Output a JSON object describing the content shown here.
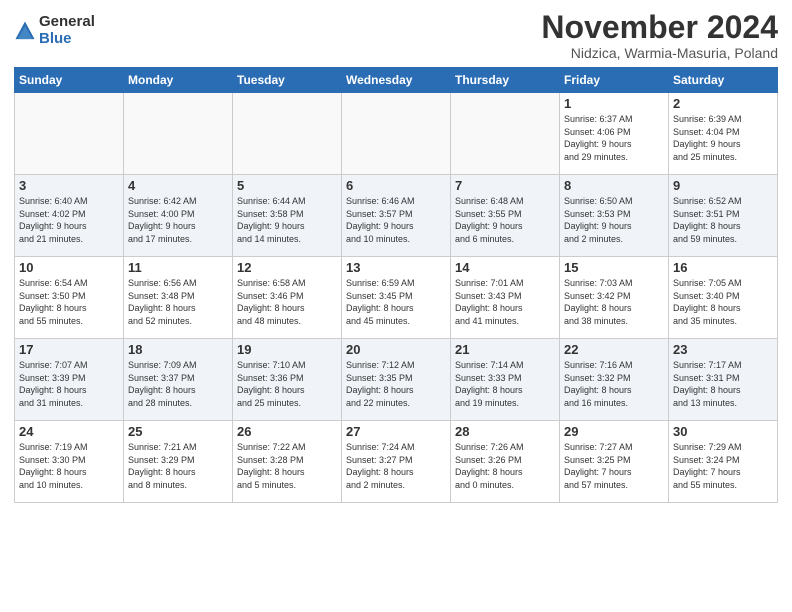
{
  "logo": {
    "general": "General",
    "blue": "Blue"
  },
  "header": {
    "month": "November 2024",
    "location": "Nidzica, Warmia-Masuria, Poland"
  },
  "weekdays": [
    "Sunday",
    "Monday",
    "Tuesday",
    "Wednesday",
    "Thursday",
    "Friday",
    "Saturday"
  ],
  "weeks": [
    [
      {
        "day": "",
        "info": ""
      },
      {
        "day": "",
        "info": ""
      },
      {
        "day": "",
        "info": ""
      },
      {
        "day": "",
        "info": ""
      },
      {
        "day": "",
        "info": ""
      },
      {
        "day": "1",
        "info": "Sunrise: 6:37 AM\nSunset: 4:06 PM\nDaylight: 9 hours\nand 29 minutes."
      },
      {
        "day": "2",
        "info": "Sunrise: 6:39 AM\nSunset: 4:04 PM\nDaylight: 9 hours\nand 25 minutes."
      }
    ],
    [
      {
        "day": "3",
        "info": "Sunrise: 6:40 AM\nSunset: 4:02 PM\nDaylight: 9 hours\nand 21 minutes."
      },
      {
        "day": "4",
        "info": "Sunrise: 6:42 AM\nSunset: 4:00 PM\nDaylight: 9 hours\nand 17 minutes."
      },
      {
        "day": "5",
        "info": "Sunrise: 6:44 AM\nSunset: 3:58 PM\nDaylight: 9 hours\nand 14 minutes."
      },
      {
        "day": "6",
        "info": "Sunrise: 6:46 AM\nSunset: 3:57 PM\nDaylight: 9 hours\nand 10 minutes."
      },
      {
        "day": "7",
        "info": "Sunrise: 6:48 AM\nSunset: 3:55 PM\nDaylight: 9 hours\nand 6 minutes."
      },
      {
        "day": "8",
        "info": "Sunrise: 6:50 AM\nSunset: 3:53 PM\nDaylight: 9 hours\nand 2 minutes."
      },
      {
        "day": "9",
        "info": "Sunrise: 6:52 AM\nSunset: 3:51 PM\nDaylight: 8 hours\nand 59 minutes."
      }
    ],
    [
      {
        "day": "10",
        "info": "Sunrise: 6:54 AM\nSunset: 3:50 PM\nDaylight: 8 hours\nand 55 minutes."
      },
      {
        "day": "11",
        "info": "Sunrise: 6:56 AM\nSunset: 3:48 PM\nDaylight: 8 hours\nand 52 minutes."
      },
      {
        "day": "12",
        "info": "Sunrise: 6:58 AM\nSunset: 3:46 PM\nDaylight: 8 hours\nand 48 minutes."
      },
      {
        "day": "13",
        "info": "Sunrise: 6:59 AM\nSunset: 3:45 PM\nDaylight: 8 hours\nand 45 minutes."
      },
      {
        "day": "14",
        "info": "Sunrise: 7:01 AM\nSunset: 3:43 PM\nDaylight: 8 hours\nand 41 minutes."
      },
      {
        "day": "15",
        "info": "Sunrise: 7:03 AM\nSunset: 3:42 PM\nDaylight: 8 hours\nand 38 minutes."
      },
      {
        "day": "16",
        "info": "Sunrise: 7:05 AM\nSunset: 3:40 PM\nDaylight: 8 hours\nand 35 minutes."
      }
    ],
    [
      {
        "day": "17",
        "info": "Sunrise: 7:07 AM\nSunset: 3:39 PM\nDaylight: 8 hours\nand 31 minutes."
      },
      {
        "day": "18",
        "info": "Sunrise: 7:09 AM\nSunset: 3:37 PM\nDaylight: 8 hours\nand 28 minutes."
      },
      {
        "day": "19",
        "info": "Sunrise: 7:10 AM\nSunset: 3:36 PM\nDaylight: 8 hours\nand 25 minutes."
      },
      {
        "day": "20",
        "info": "Sunrise: 7:12 AM\nSunset: 3:35 PM\nDaylight: 8 hours\nand 22 minutes."
      },
      {
        "day": "21",
        "info": "Sunrise: 7:14 AM\nSunset: 3:33 PM\nDaylight: 8 hours\nand 19 minutes."
      },
      {
        "day": "22",
        "info": "Sunrise: 7:16 AM\nSunset: 3:32 PM\nDaylight: 8 hours\nand 16 minutes."
      },
      {
        "day": "23",
        "info": "Sunrise: 7:17 AM\nSunset: 3:31 PM\nDaylight: 8 hours\nand 13 minutes."
      }
    ],
    [
      {
        "day": "24",
        "info": "Sunrise: 7:19 AM\nSunset: 3:30 PM\nDaylight: 8 hours\nand 10 minutes."
      },
      {
        "day": "25",
        "info": "Sunrise: 7:21 AM\nSunset: 3:29 PM\nDaylight: 8 hours\nand 8 minutes."
      },
      {
        "day": "26",
        "info": "Sunrise: 7:22 AM\nSunset: 3:28 PM\nDaylight: 8 hours\nand 5 minutes."
      },
      {
        "day": "27",
        "info": "Sunrise: 7:24 AM\nSunset: 3:27 PM\nDaylight: 8 hours\nand 2 minutes."
      },
      {
        "day": "28",
        "info": "Sunrise: 7:26 AM\nSunset: 3:26 PM\nDaylight: 8 hours\nand 0 minutes."
      },
      {
        "day": "29",
        "info": "Sunrise: 7:27 AM\nSunset: 3:25 PM\nDaylight: 7 hours\nand 57 minutes."
      },
      {
        "day": "30",
        "info": "Sunrise: 7:29 AM\nSunset: 3:24 PM\nDaylight: 7 hours\nand 55 minutes."
      }
    ]
  ]
}
